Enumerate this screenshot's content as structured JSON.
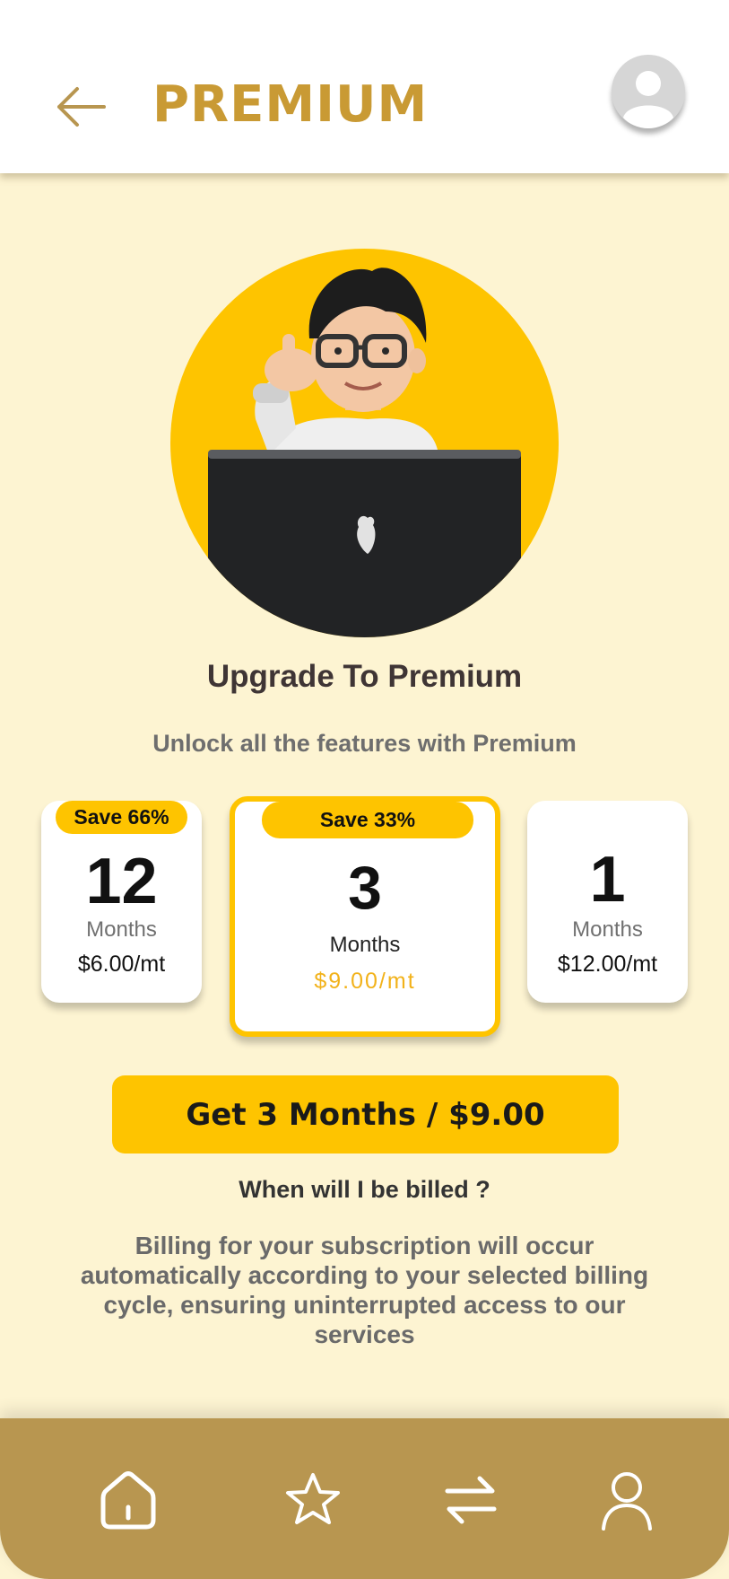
{
  "header": {
    "title": "PREMIUM",
    "back_icon": "arrow-left-icon",
    "avatar_icon": "user-avatar-icon"
  },
  "hero": {
    "image": "memoji-with-laptop",
    "heading": "Upgrade To Premium",
    "subheading": "Unlock all the features with Premium"
  },
  "plans": [
    {
      "badge": "Save 66%",
      "duration": "12",
      "unit": "Months",
      "price": "$6.00/mt",
      "selected": false
    },
    {
      "badge": "Save 33%",
      "duration": "3",
      "unit": "Months",
      "price": "$9.00/mt",
      "selected": true
    },
    {
      "duration": "1",
      "unit": "Months",
      "price": "$12.00/mt",
      "selected": false
    }
  ],
  "cta": {
    "label": "Get 3 Months / $9.00"
  },
  "faq": {
    "question": "When  will I be billed ?",
    "answer": "Billing for your subscription will occur automatically according to your selected billing cycle, ensuring uninterrupted access to our services"
  },
  "nav": {
    "items": [
      {
        "icon": "home-icon"
      },
      {
        "icon": "star-icon"
      },
      {
        "icon": "exchange-icon"
      },
      {
        "icon": "profile-icon"
      }
    ]
  },
  "colors": {
    "accent": "#fec400",
    "brand_gold": "#c99a34",
    "background": "#fdf4d2",
    "nav_bg": "#b89650"
  }
}
